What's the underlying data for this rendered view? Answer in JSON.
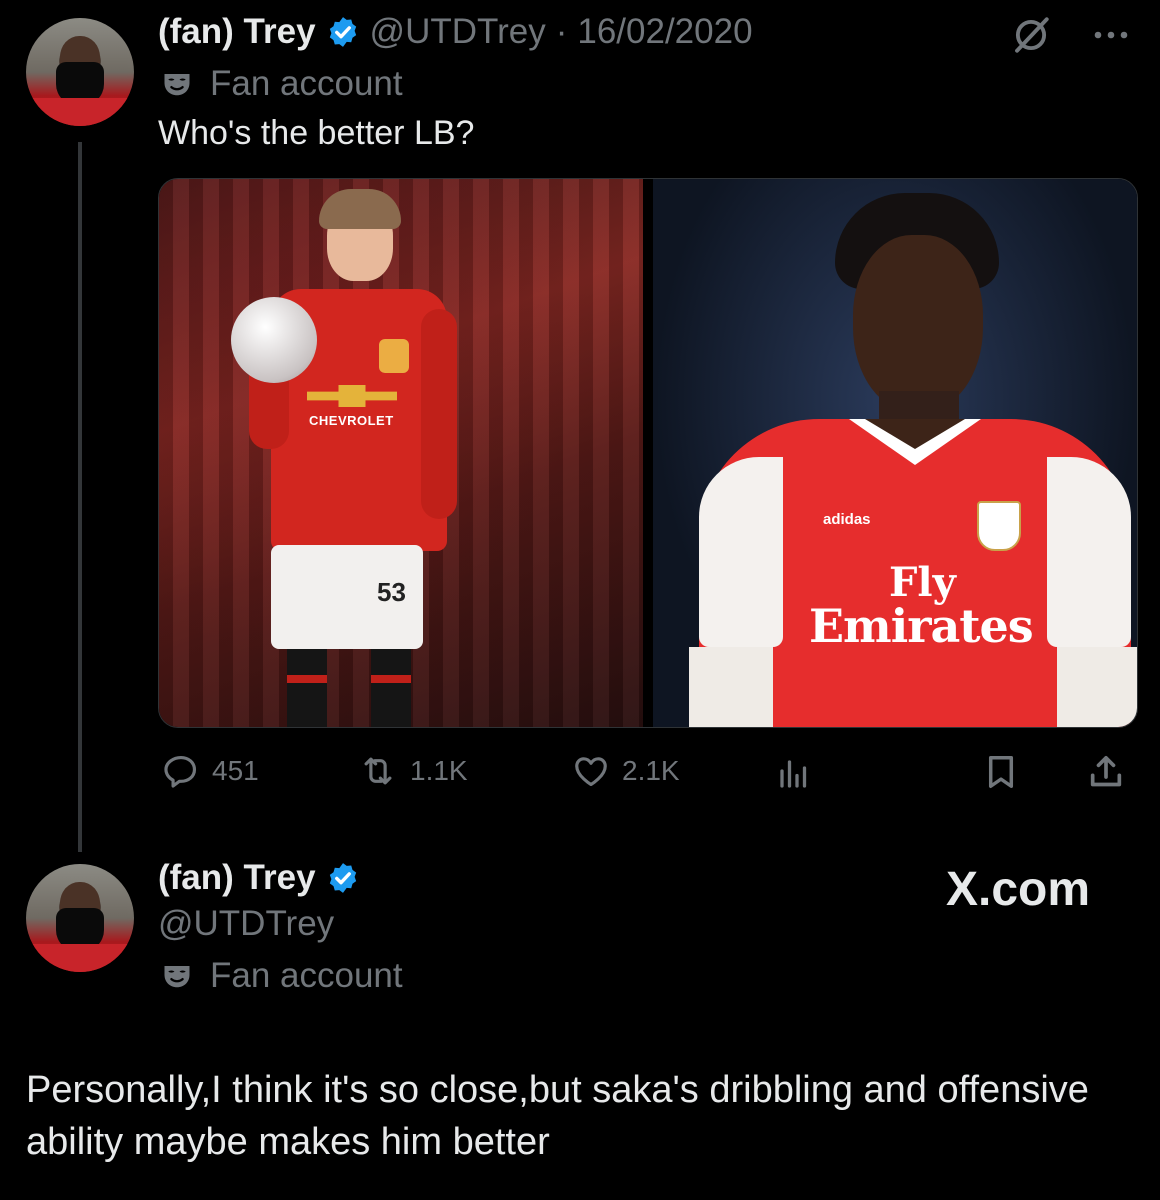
{
  "tweet": {
    "display_name": "(fan) Trey",
    "handle": "@UTDTrey",
    "separator": "·",
    "date": "16/02/2020",
    "label": "Fan account",
    "text": "Who's the better LB?",
    "images": [
      {
        "kit_sponsor": "CHEVROLET",
        "shirt_number": "53"
      },
      {
        "kit_brand": "adidas",
        "sponsor_line1": "Fly",
        "sponsor_line2": "Emirates"
      }
    ],
    "stats": {
      "replies": "451",
      "reposts": "1.1K",
      "likes": "2.1K"
    }
  },
  "reply": {
    "display_name": "(fan) Trey",
    "handle": "@UTDTrey",
    "label": "Fan account",
    "watermark": "X.com",
    "text": "Personally,I think it's so close,but saka's dribbling and offensive ability maybe makes him better"
  },
  "colors": {
    "background": "#000000",
    "text": "#e7e9ea",
    "muted": "#71767b",
    "verified": "#1d9bf0"
  },
  "icons": [
    "verified-badge-icon",
    "grok-icon",
    "more-icon",
    "mask-icon",
    "reply-icon",
    "repost-icon",
    "like-icon",
    "views-icon",
    "bookmark-icon",
    "share-icon"
  ]
}
